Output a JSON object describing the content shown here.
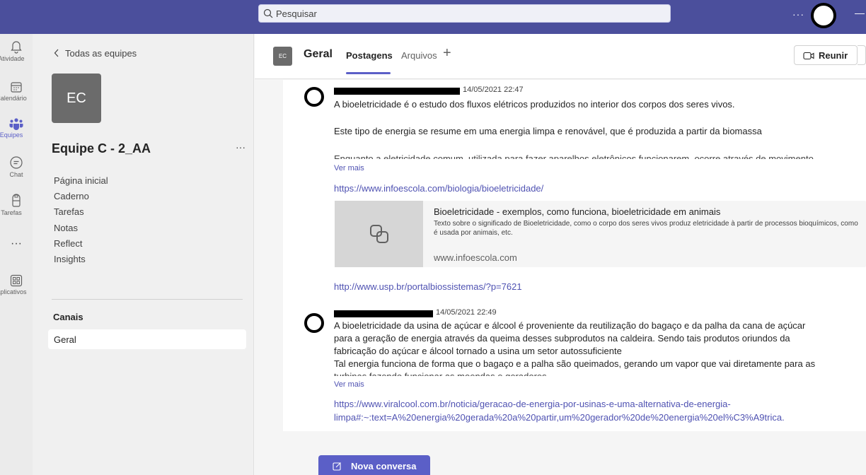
{
  "titlebar": {
    "expand_icon": "chevron-right-icon",
    "search_placeholder": "Pesquisar",
    "more": "···",
    "minimize": "—"
  },
  "rail": {
    "items": [
      {
        "label": "Atividade",
        "icon": "bell-icon"
      },
      {
        "label": "Calendário",
        "icon": "calendar-icon"
      },
      {
        "label": "Equipes",
        "icon": "teams-icon"
      },
      {
        "label": "Chat",
        "icon": "chat-icon"
      },
      {
        "label": "Tarefas",
        "icon": "tasks-icon"
      },
      {
        "label": "",
        "icon": "more-icon",
        "glyph": "···"
      },
      {
        "label": "Aplicativos",
        "icon": "apps-icon"
      }
    ]
  },
  "team": {
    "back_label": "Todas as equipes",
    "avatar_initials": "EC",
    "name": "Equipe C - 2_AA",
    "more": "···",
    "menu": [
      "Página inicial",
      "Caderno",
      "Tarefas",
      "Notas",
      "Reflect",
      "Insights"
    ],
    "channels_heading": "Canais",
    "channels": [
      "Geral"
    ]
  },
  "channel": {
    "avatar_initials": "EC",
    "title": "Geral",
    "tabs": [
      "Postagens",
      "Arquivos"
    ],
    "add_tab": "+",
    "meet_label": "Reunir"
  },
  "posts": [
    {
      "timestamp": "14/05/2021 22:47",
      "lines": [
        "A bioeletricidade é o estudo dos fluxos elétricos produzidos no interior dos corpos dos seres vivos.",
        "Este tipo de energia se resume em uma energia limpa e renovável, que é produzida a partir da biomassa",
        "Enquanto a eletricidade comum, utilizada para fazer aparelhos eletrônicos funcionarem, ocorre através de movimento"
      ],
      "see_more": "Ver mais",
      "link1": "https://www.infoescola.com/biologia/bioeletricidade/",
      "card": {
        "title": "Bioeletricidade - exemplos, como funciona, bioeletricidade em animais",
        "description": "Texto sobre o significado de Bioeletricidade, como o corpo dos seres vivos produz eletricidade à partir de processos bioquímicos, como é usada por animais, etc.",
        "site": "www.infoescola.com"
      },
      "link2": "http://www.usp.br/portalbiossistemas/?p=7621"
    },
    {
      "timestamp": "14/05/2021 22:49",
      "lines": [
        "A bioeletricidade da usina de açúcar e álcool é proveniente da reutilização do bagaço e da palha da cana de açúcar",
        "para a geração de energia através da queima desses subprodutos na caldeira. Sendo tais produtos oriundos da",
        "fabricação do açúcar e álcool tornado a usina um setor autossuficiente",
        "Tal energia funciona de forma que o bagaço e a palha são queimados, gerando um vapor que vai diretamente para as",
        "turbinas fazendo funcionar as moendas e geradores"
      ],
      "see_more": "Ver mais",
      "link1_line1": "https://www.viralcool.com.br/noticia/geracao-de-energia-por-usinas-e-uma-alternativa-de-energia-",
      "link1_line2": "limpa#:~:text=A%20energia%20gerada%20a%20partir,um%20gerador%20de%20energia%20el%C3%A9trica."
    }
  ],
  "new_conversation": "Nova conversa"
}
